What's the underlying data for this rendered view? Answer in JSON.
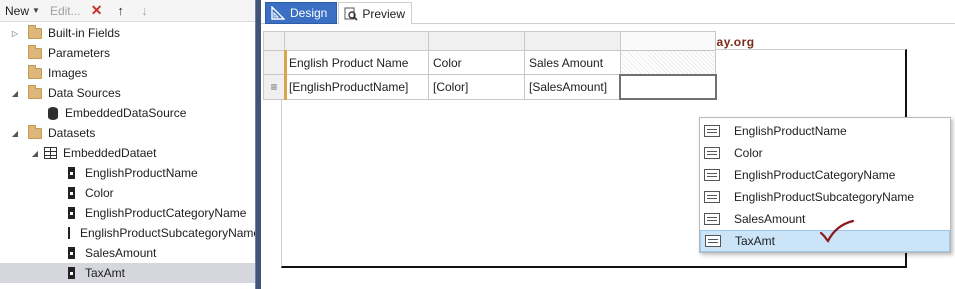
{
  "left_pane": {
    "toolbar": {
      "new_label": "New",
      "edit_label": "Edit...",
      "icons": [
        "delete-icon",
        "move-up-icon",
        "move-down-icon"
      ]
    },
    "tree": [
      {
        "label": "Built-in Fields",
        "expander": "collapsed",
        "icon": "folder-icon",
        "level": 0
      },
      {
        "label": "Parameters",
        "expander": "none",
        "icon": "folder-icon",
        "level": 0
      },
      {
        "label": "Images",
        "expander": "none",
        "icon": "folder-icon",
        "level": 0
      },
      {
        "label": "Data Sources",
        "expander": "expanded",
        "icon": "folder-icon",
        "level": 0
      },
      {
        "label": "EmbeddedDataSource",
        "expander": "none",
        "icon": "database-icon",
        "level": 1
      },
      {
        "label": "Datasets",
        "expander": "expanded",
        "icon": "folder-icon",
        "level": 0
      },
      {
        "label": "EmbeddedDataet",
        "expander": "expanded",
        "icon": "dataset-grid-icon",
        "level": 1
      },
      {
        "label": "EnglishProductName",
        "expander": "none",
        "icon": "field-icon",
        "level": 2
      },
      {
        "label": "Color",
        "expander": "none",
        "icon": "field-icon",
        "level": 2
      },
      {
        "label": "EnglishProductCategoryName",
        "expander": "none",
        "icon": "field-icon",
        "level": 2
      },
      {
        "label": "EnglishProductSubcategoryName",
        "expander": "none",
        "icon": "field-icon",
        "level": 2
      },
      {
        "label": "SalesAmount",
        "expander": "none",
        "icon": "field-icon",
        "level": 2
      },
      {
        "label": "TaxAmt",
        "expander": "none",
        "icon": "field-icon",
        "level": 2,
        "selected": true
      }
    ]
  },
  "designer": {
    "tabs": {
      "design": "Design",
      "preview": "Preview",
      "active": "design"
    },
    "watermark": "©tutorialgateway.org",
    "tablix": {
      "headers": [
        "English Product Name",
        "Color",
        "Sales Amount",
        ""
      ],
      "data_row": [
        "[EnglishProductName]",
        "[Color]",
        "[SalesAmount]",
        ""
      ],
      "row_group_marker": "≡"
    },
    "field_dropdown": {
      "items": [
        "EnglishProductName",
        "Color",
        "EnglishProductCategoryName",
        "EnglishProductSubcategoryName",
        "SalesAmount",
        "TaxAmt"
      ],
      "selected": "TaxAmt"
    }
  },
  "colors": {
    "design_tab_active": "#3a6fc4",
    "splitter": "#42537a",
    "tree_selection": "#d6d6df",
    "dropdown_selection": "#cce4f7",
    "watermark": "#7a2a19",
    "checkmark": "#8b1a1a",
    "delete_icon": "#c9302c"
  }
}
